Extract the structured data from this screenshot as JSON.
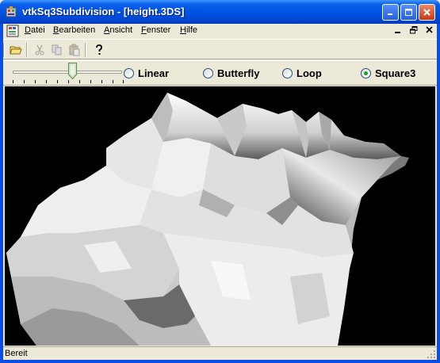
{
  "window": {
    "title": "vtkSq3Subdivision - [height.3DS]"
  },
  "icons": {
    "app": "vtk-app-icon",
    "document": "document-icon",
    "minimize": "minimize-icon",
    "maximize": "maximize-icon",
    "close": "close-icon"
  },
  "menubar": {
    "items": [
      {
        "label_underline": "D",
        "label_rest": "atei"
      },
      {
        "label_underline": "B",
        "label_rest": "earbeiten"
      },
      {
        "label_underline": "A",
        "label_rest": "nsicht"
      },
      {
        "label_underline": "F",
        "label_rest": "enster"
      },
      {
        "label_underline": "H",
        "label_rest": "ilfe"
      }
    ]
  },
  "toolbar": {
    "tools": [
      "open-folder-icon",
      "cut-icon",
      "copy-icon",
      "paste-icon",
      "help-icon"
    ]
  },
  "controls": {
    "slider_value": 0.55,
    "radios": [
      {
        "label": "Linear",
        "selected": false
      },
      {
        "label": "Butterfly",
        "selected": false
      },
      {
        "label": "Loop",
        "selected": false
      },
      {
        "label": "Square3",
        "selected": true
      }
    ]
  },
  "statusbar": {
    "text": "Bereit"
  },
  "colors": {
    "titlebar": "#0054e3",
    "chrome": "#ece9d8",
    "viewport_background": "#000000",
    "radio_selected": "#21a121"
  }
}
